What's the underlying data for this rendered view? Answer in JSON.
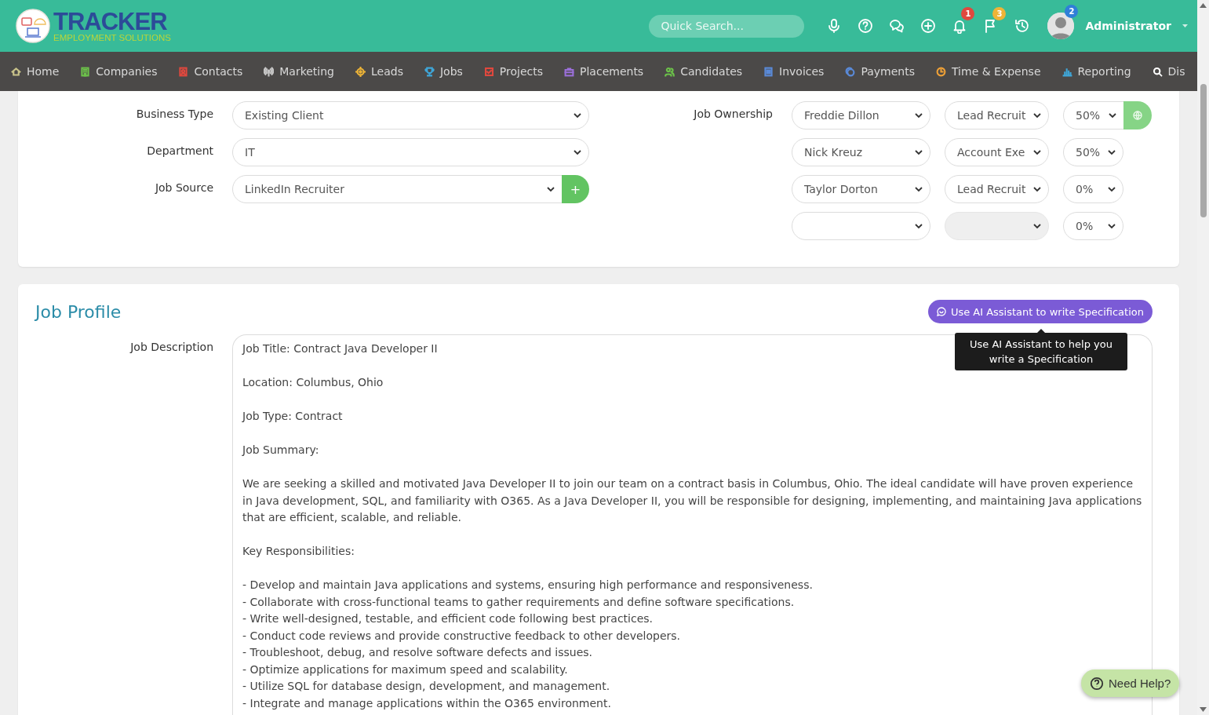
{
  "header": {
    "logo": {
      "title": "TRACKER",
      "subtitle": "EMPLOYMENT SOLUTIONS"
    },
    "search": {
      "placeholder": "Quick Search..."
    },
    "icons": [
      {
        "kind": "mic"
      },
      {
        "kind": "help"
      },
      {
        "kind": "chat"
      },
      {
        "kind": "add"
      },
      {
        "kind": "bell",
        "badge": "1",
        "color": "#e0483e"
      },
      {
        "kind": "flag",
        "badge": "3",
        "color": "#eeb437"
      },
      {
        "kind": "history"
      }
    ],
    "user": {
      "name": "Administrator",
      "badge": "2",
      "color": "#2f7fd8"
    }
  },
  "nav": {
    "items": [
      {
        "label": "Home",
        "kind": "home",
        "color": "#c9c38a"
      },
      {
        "label": "Companies",
        "kind": "building",
        "color": "#6cc24a"
      },
      {
        "label": "Contacts",
        "kind": "contact",
        "color": "#e0483e"
      },
      {
        "label": "Marketing",
        "kind": "antenna",
        "color": "#c8c8c8"
      },
      {
        "label": "Leads",
        "kind": "target",
        "color": "#eeb437"
      },
      {
        "label": "Jobs",
        "kind": "trophy",
        "color": "#3fa6d8"
      },
      {
        "label": "Projects",
        "kind": "check",
        "color": "#e0483e"
      },
      {
        "label": "Placements",
        "kind": "briefcase",
        "color": "#9a6fd8"
      },
      {
        "label": "Candidates",
        "kind": "users",
        "color": "#6cc24a"
      },
      {
        "label": "Invoices",
        "kind": "doc",
        "color": "#5a8ad8"
      },
      {
        "label": "Payments",
        "kind": "coin",
        "color": "#5a8ad8"
      },
      {
        "label": "Time & Expense",
        "kind": "clock",
        "color": "#eea037"
      },
      {
        "label": "Reporting",
        "kind": "chart",
        "color": "#3fa6d8"
      },
      {
        "label": "Dis",
        "kind": "search",
        "color": "#ffffff"
      }
    ]
  },
  "job_details": {
    "fields": [
      {
        "label": "Business Type",
        "value": "Existing Client",
        "kind": "select"
      },
      {
        "label": "Department",
        "value": "IT",
        "kind": "select"
      },
      {
        "label": "Job Source",
        "value": "LinkedIn Recruiter",
        "kind": "select_add",
        "button": "+"
      }
    ],
    "ownership": {
      "label": "Job Ownership",
      "rows": [
        {
          "owner": "Freddie Dillon",
          "role": "Lead Recruit",
          "share": "50%",
          "role_disabled": false,
          "kind": "share_button"
        },
        {
          "owner": "Nick Kreuz",
          "role": "Account Exe",
          "share": "50%",
          "role_disabled": false,
          "kind": "plain"
        },
        {
          "owner": "Taylor Dorton",
          "role": "Lead Recruit",
          "share": "0%",
          "role_disabled": false,
          "kind": "plain"
        },
        {
          "share": "0%",
          "role_disabled": true,
          "kind": "plain"
        }
      ]
    }
  },
  "job_profile": {
    "title": "Job Profile",
    "ai_button": "Use AI Assistant to write Specification",
    "tooltip": "Use AI Assistant to help you write a Specification",
    "description_label": "Job Description",
    "paragraphs": [
      "Job Title: Contract Java Developer II",
      "Location: Columbus, Ohio",
      "Job Type: Contract",
      "Job Summary:",
      "We are seeking a skilled and motivated Java Developer II to join our team on a contract basis in Columbus, Ohio. The ideal candidate will have proven experience in Java development, SQL, and familiarity with O365. As a Java Developer II, you will be responsible for designing, implementing, and maintaining Java applications that are efficient, scalable, and reliable.",
      "Key Responsibilities:",
      "- Develop and maintain Java applications and systems, ensuring high performance and responsiveness.\n- Collaborate with cross-functional teams to gather requirements and define software specifications.\n- Write well-designed, testable, and efficient code following best practices.\n- Conduct code reviews and provide constructive feedback to other developers.\n- Troubleshoot, debug, and resolve software defects and issues.\n- Optimize applications for maximum speed and scalability.\n- Utilize SQL for database design, development, and management.\n- Integrate and manage applications within the O365 environment."
    ]
  },
  "help_button": "Need Help?"
}
